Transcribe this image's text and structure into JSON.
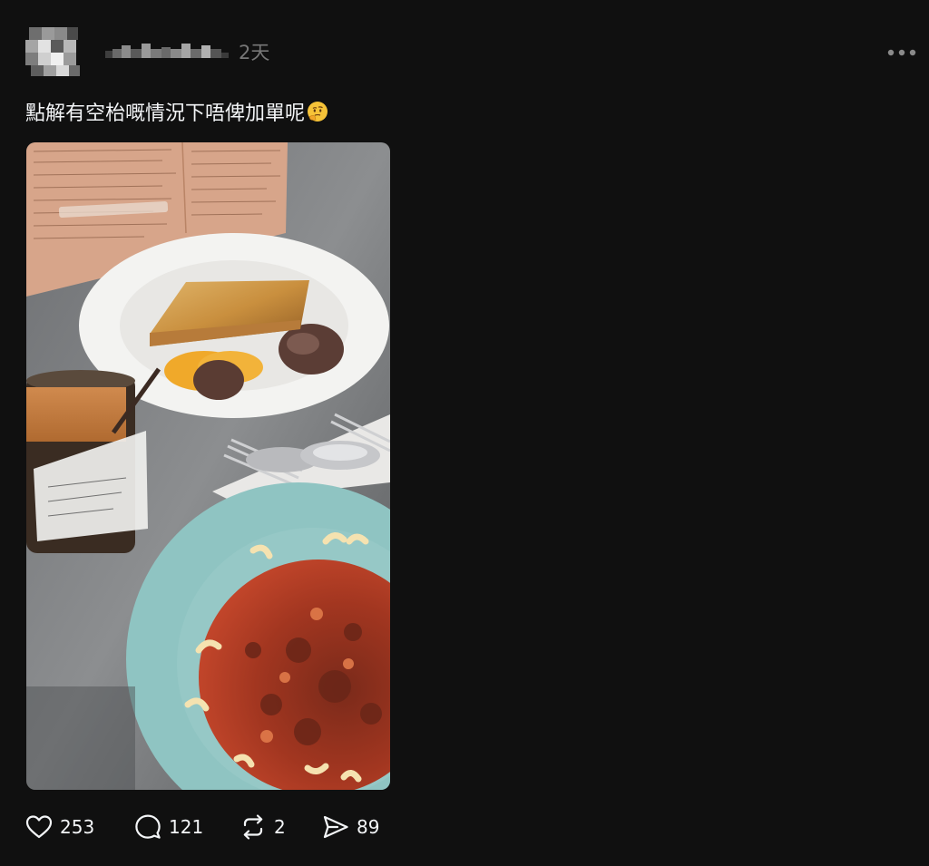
{
  "post": {
    "timestamp": "2天",
    "caption": "點解有空枱嘅情況下唔俾加單呢",
    "caption_emoji": "thinking-face-emoji",
    "image_alt": "Photo of cafe meal: baked pork chop rice plate with toast and beef, milk tea, and macaroni in tomato meat sauce"
  },
  "actions": {
    "likes": "253",
    "comments": "121",
    "reposts": "2",
    "shares": "89"
  },
  "icons": {
    "more": "more-horizontal-icon",
    "like": "heart-icon",
    "comment": "comment-bubble-icon",
    "repost": "repost-icon",
    "share": "send-icon"
  },
  "colors": {
    "background": "#101010",
    "text": "#f3f5f7",
    "muted": "#777777"
  }
}
